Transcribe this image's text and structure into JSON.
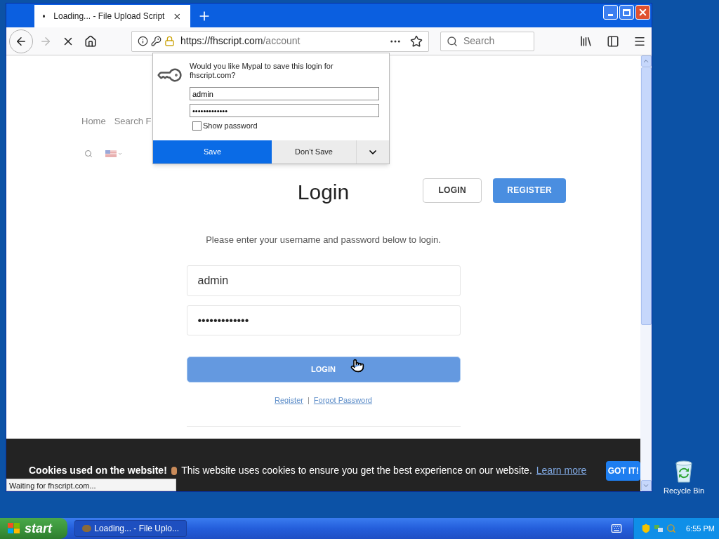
{
  "browser": {
    "tab": {
      "title": "Loading... - File Upload Script",
      "loading": true
    },
    "nav_buttons": [
      {
        "kind": "back",
        "disabled": false
      },
      {
        "kind": "forward",
        "disabled": true
      },
      {
        "kind": "stop",
        "disabled": false
      },
      {
        "kind": "home",
        "disabled": false
      }
    ],
    "address": {
      "host": "https://fhscript.com",
      "path": "/account"
    },
    "search": {
      "placeholder": "Search"
    }
  },
  "save_login_popup": {
    "message": "Would you like Mypal to save this login for fhscript.com?",
    "username": "admin",
    "password": "•••••••••••••",
    "show_password": {
      "label": "Show password",
      "checked": false
    },
    "buttons": [
      {
        "label": "Save",
        "kind": "primary"
      },
      {
        "label": "Don’t Save",
        "kind": "secondary"
      }
    ]
  },
  "site": {
    "nav": [
      "Home",
      "Search F"
    ],
    "header_buttons": [
      {
        "label": "LOGIN",
        "kind": "outline"
      },
      {
        "label": "REGISTER",
        "kind": "filled"
      }
    ],
    "heading": "Login",
    "instruction": "Please enter your username and password below to login.",
    "username": "admin",
    "password": "•••••••••••••",
    "submit": "LOGIN",
    "links": [
      "Register",
      "Forgot Password"
    ],
    "separator": "|"
  },
  "cookie_banner": {
    "title": "Cookies used on the website!",
    "message": "This website uses cookies to ensure you get the best experience on our website.",
    "link": "Learn more",
    "button": "GOT IT!"
  },
  "status_bar": "Waiting for fhscript.com...",
  "desktop_icons": [
    {
      "label": "Recycle Bin"
    }
  ],
  "taskbar": {
    "start": "start",
    "tasks": [
      {
        "label": "Loading... - File Uplo..."
      }
    ],
    "time": "6:55 PM"
  }
}
